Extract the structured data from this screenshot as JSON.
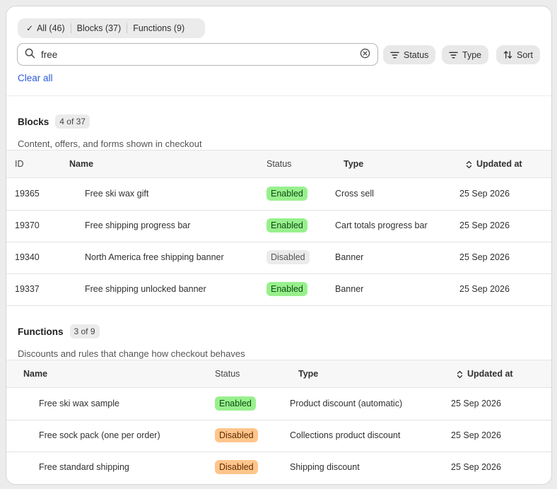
{
  "filters": {
    "tabs": [
      {
        "label": "All (46)",
        "active": true
      },
      {
        "label": "Blocks (37)",
        "active": false
      },
      {
        "label": "Functions (9)",
        "active": false
      }
    ],
    "search_value": "free",
    "status_label": "Status",
    "type_label": "Type",
    "sort_label": "Sort",
    "clear_all_label": "Clear all"
  },
  "blocks": {
    "title": "Blocks",
    "count": "4 of 37",
    "description": "Content, offers, and forms shown in checkout",
    "headers": {
      "id": "ID",
      "name": "Name",
      "status": "Status",
      "type": "Type",
      "updated": "Updated at"
    },
    "rows": [
      {
        "id": "19365",
        "name": "Free ski wax gift",
        "status": "Enabled",
        "type": "Cross sell",
        "updated": "25 Sep 2026"
      },
      {
        "id": "19370",
        "name": "Free shipping progress bar",
        "status": "Enabled",
        "type": "Cart totals progress bar",
        "updated": "25 Sep 2026"
      },
      {
        "id": "19340",
        "name": "North America free shipping banner",
        "status": "Disabled",
        "type": "Banner",
        "updated": "25 Sep 2026"
      },
      {
        "id": "19337",
        "name": "Free shipping unlocked banner",
        "status": "Enabled",
        "type": "Banner",
        "updated": "25 Sep 2026"
      }
    ]
  },
  "functions": {
    "title": "Functions",
    "count": "3 of 9",
    "description": "Discounts and rules that change how checkout behaves",
    "headers": {
      "name": "Name",
      "status": "Status",
      "type": "Type",
      "updated": "Updated at"
    },
    "rows": [
      {
        "name": "Free ski wax sample",
        "status": "Enabled",
        "type": "Product discount (automatic)",
        "updated": "25 Sep 2026"
      },
      {
        "name": "Free sock pack (one per order)",
        "status": "Disabled",
        "type": "Collections product discount",
        "updated": "25 Sep 2026"
      },
      {
        "name": "Free standard shipping",
        "status": "Disabled",
        "type": "Shipping discount",
        "updated": "25 Sep 2026"
      }
    ]
  },
  "colors": {
    "enabled_badge": "#98f08d",
    "disabled_badge_blocks": "#ebebeb",
    "disabled_badge_functions": "#ffc58b",
    "link": "#2a5bd7"
  }
}
